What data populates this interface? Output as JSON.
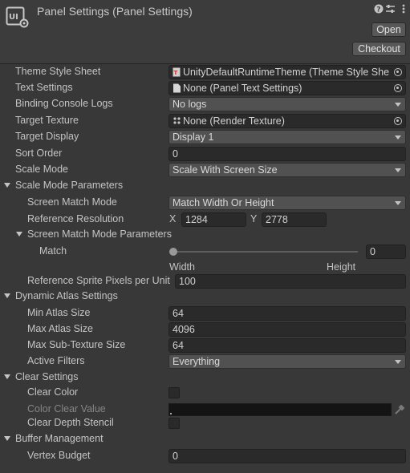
{
  "header": {
    "title": "Panel Settings (Panel Settings)",
    "open_label": "Open",
    "checkout_label": "Checkout",
    "icons": [
      "help-icon",
      "presets-icon",
      "more-options-icon"
    ]
  },
  "fields": {
    "theme_style_sheet": {
      "label": "Theme Style Sheet",
      "value": "UnityDefaultRuntimeTheme (Theme Style Shee"
    },
    "text_settings": {
      "label": "Text Settings",
      "value": "None (Panel Text Settings)"
    },
    "binding_console_logs": {
      "label": "Binding Console Logs",
      "value": "No logs"
    },
    "target_texture": {
      "label": "Target Texture",
      "value": "None (Render Texture)"
    },
    "target_display": {
      "label": "Target Display",
      "value": "Display 1"
    },
    "sort_order": {
      "label": "Sort Order",
      "value": "0"
    },
    "scale_mode": {
      "label": "Scale Mode",
      "value": "Scale With Screen Size"
    }
  },
  "scale_mode_parameters": {
    "label": "Scale Mode Parameters",
    "screen_match_mode": {
      "label": "Screen Match Mode",
      "value": "Match Width Or Height"
    },
    "reference_resolution": {
      "label": "Reference Resolution",
      "x_label": "X",
      "x": "1284",
      "y_label": "Y",
      "y": "2778"
    },
    "screen_match_mode_parameters": {
      "label": "Screen Match Mode Parameters",
      "match": {
        "label": "Match",
        "value": "0",
        "slider_fraction": 0,
        "min_label": "Width",
        "max_label": "Height"
      }
    },
    "reference_sprite_pixels": {
      "label": "Reference Sprite Pixels per Unit",
      "value": "100"
    }
  },
  "dynamic_atlas_settings": {
    "label": "Dynamic Atlas Settings",
    "min_atlas_size": {
      "label": "Min Atlas Size",
      "value": "64"
    },
    "max_atlas_size": {
      "label": "Max Atlas Size",
      "value": "4096"
    },
    "max_sub_texture_size": {
      "label": "Max Sub-Texture Size",
      "value": "64"
    },
    "active_filters": {
      "label": "Active Filters",
      "value": "Everything"
    }
  },
  "clear_settings": {
    "label": "Clear Settings",
    "clear_color": {
      "label": "Clear Color",
      "checked": false
    },
    "color_clear_value": {
      "label": "Color Clear Value",
      "color": "#000000"
    },
    "clear_depth_stencil": {
      "label": "Clear Depth Stencil",
      "checked": false
    }
  },
  "buffer_management": {
    "label": "Buffer Management",
    "vertex_budget": {
      "label": "Vertex Budget",
      "value": "0"
    }
  },
  "colors": {
    "background": "#383838",
    "field": "#2a2a2a",
    "dropdown": "#515151",
    "text": "#c4c4c4"
  }
}
